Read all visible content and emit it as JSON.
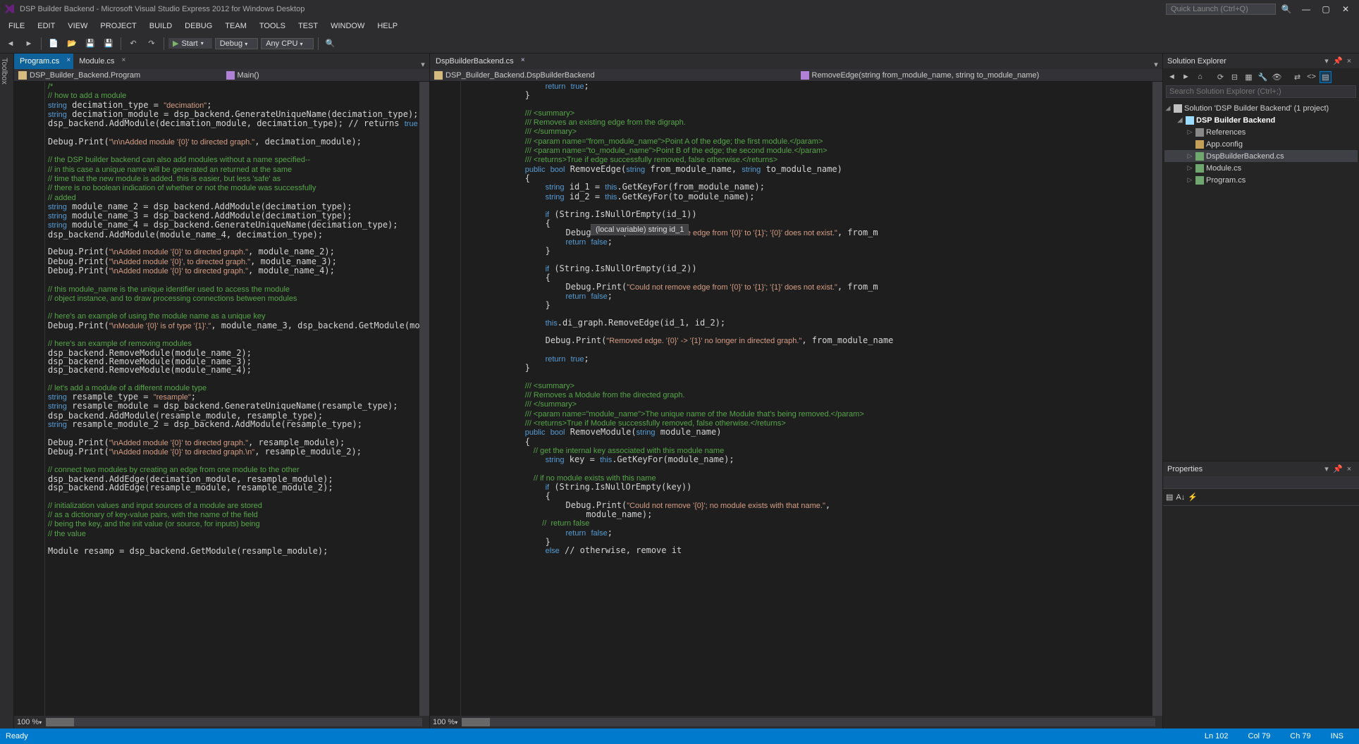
{
  "title": "DSP Builder Backend - Microsoft Visual Studio Express 2012 for Windows Desktop",
  "quicklaunch": "Quick Launch (Ctrl+Q)",
  "menu": [
    "FILE",
    "EDIT",
    "VIEW",
    "PROJECT",
    "BUILD",
    "DEBUG",
    "TEAM",
    "TOOLS",
    "TEST",
    "WINDOW",
    "HELP"
  ],
  "start": "Start",
  "config": "Debug",
  "platform": "Any CPU",
  "pane1": {
    "tabs": [
      "Program.cs",
      "Module.cs"
    ],
    "nav_left": "DSP_Builder_Backend.Program",
    "nav_right": "Main()",
    "zoom": "100 %",
    "code": "/*\n// how to add a module\nstring decimation_type = \"decimation\";\nstring decimation_module = dsp_backend.GenerateUniqueName(decimation_type);\ndsp_backend.AddModule(decimation_module, decimation_type); // returns true as long as nam\n\nDebug.Print(\"\\n\\nAdded module '{0}' to directed graph.\", decimation_module);\n\n// the DSP builder backend can also add modules without a name specified--\n// in this case a unique name will be generated an returned at the same\n// time that the new module is added. this is easier, but less 'safe' as\n// there is no boolean indication of whether or not the module was successfully\n// added\nstring module_name_2 = dsp_backend.AddModule(decimation_type);\nstring module_name_3 = dsp_backend.AddModule(decimation_type);\nstring module_name_4 = dsp_backend.GenerateUniqueName(decimation_type);\ndsp_backend.AddModule(module_name_4, decimation_type);\n\nDebug.Print(\"\\nAdded module '{0}' to directed graph.\", module_name_2);\nDebug.Print(\"\\nAdded module '{0}', to directed graph.\", module_name_3);\nDebug.Print(\"\\nAdded module '{0}' to directed graph.\", module_name_4);\n\n// this module_name is the unique identifier used to access the module\n// object instance, and to draw processing connections between modules\n\n// here's an example of using the module name as a unique key\nDebug.Print(\"\\nModule '{0}' is of type '{1}'.\", module_name_3, dsp_backend.GetModule(modul\n\n// here's an example of removing modules\ndsp_backend.RemoveModule(module_name_2);\ndsp_backend.RemoveModule(module_name_3);\ndsp_backend.RemoveModule(module_name_4);\n\n// let's add a module of a different module type\nstring resample_type = \"resample\";\nstring resample_module = dsp_backend.GenerateUniqueName(resample_type);\ndsp_backend.AddModule(resample_module, resample_type);\nstring resample_module_2 = dsp_backend.AddModule(resample_type);\n\nDebug.Print(\"\\nAdded module '{0}' to directed graph.\", resample_module);\nDebug.Print(\"\\nAdded module '{0}' to directed graph.\\n\", resample_module_2);\n\n// connect two modules by creating an edge from one module to the other\ndsp_backend.AddEdge(decimation_module, resample_module);\ndsp_backend.AddEdge(resample_module, resample_module_2);\n\n// initialization values and input sources of a module are stored\n// as a dictionary of key-value pairs, with the name of the field\n// being the key, and the init value (or source, for inputs) being\n// the value\n\nModule resamp = dsp_backend.GetModule(resample_module);"
  },
  "pane2": {
    "tabs": [
      "DspBuilderBackend.cs"
    ],
    "nav_left": "DSP_Builder_Backend.DspBuilderBackend",
    "nav_right": "RemoveEdge(string from_module_name, string to_module_name)",
    "zoom": "100 %",
    "tooltip": "(local variable) string id_1",
    "code": "    return true;\n}\n\n/// <summary>\n/// Removes an existing edge from the digraph.\n/// </summary>\n/// <param name=\"from_module_name\">Point A of the edge; the first module.</param>\n/// <param name=\"to_module_name\">Point B of the edge; the second module.</param>\n/// <returns>True if edge successfully removed, false otherwise.</returns>\npublic bool RemoveEdge(string from_module_name, string to_module_name)\n{\n    string id_1 = this.GetKeyFor(from_module_name);\n    string id_2 = this.GetKeyFor(to_module_name);\n\n    if (String.IsNullOrEmpty(id_1))\n    {\n        Debug.Print(\"Could not remove edge from '{0}' to '{1}'; '{0}' does not exist.\", from_m\n        return false;\n    }\n\n    if (String.IsNullOrEmpty(id_2))\n    {\n        Debug.Print(\"Could not remove edge from '{0}' to '{1}'; '{1}' does not exist.\", from_m\n        return false;\n    }\n\n    this.di_graph.RemoveEdge(id_1, id_2);\n\n    Debug.Print(\"Removed edge. '{0}' -> '{1}' no longer in directed graph.\", from_module_name\n\n    return true;\n}\n\n/// <summary>\n/// Removes a Module from the directed graph.\n/// </summary>\n/// <param name=\"module_name\">The unique name of the Module that's being removed.</param>\n/// <returns>True if Module successfully removed, false otherwise.</returns>\npublic bool RemoveModule(string module_name)\n{\n    // get the internal key associated with this module name\n    string key = this.GetKeyFor(module_name);\n\n    // if no module exists with this name\n    if (String.IsNullOrEmpty(key))\n    {\n        Debug.Print(\"Could not remove '{0}'; no module exists with that name.\",\n            module_name);\n        //  return false\n        return false;\n    }\n    else // otherwise, remove it"
  },
  "solution": {
    "title": "Solution Explorer",
    "search": "Search Solution Explorer (Ctrl+;)",
    "root": "Solution 'DSP Builder Backend' (1 project)",
    "project": "DSP Builder Backend",
    "refs": "References",
    "appconfig": "App.config",
    "files": [
      "DspBuilderBackend.cs",
      "Module.cs",
      "Program.cs"
    ]
  },
  "props": {
    "title": "Properties"
  },
  "status": {
    "ready": "Ready",
    "ln": "Ln 102",
    "col": "Col 79",
    "ch": "Ch 79",
    "ins": "INS"
  }
}
